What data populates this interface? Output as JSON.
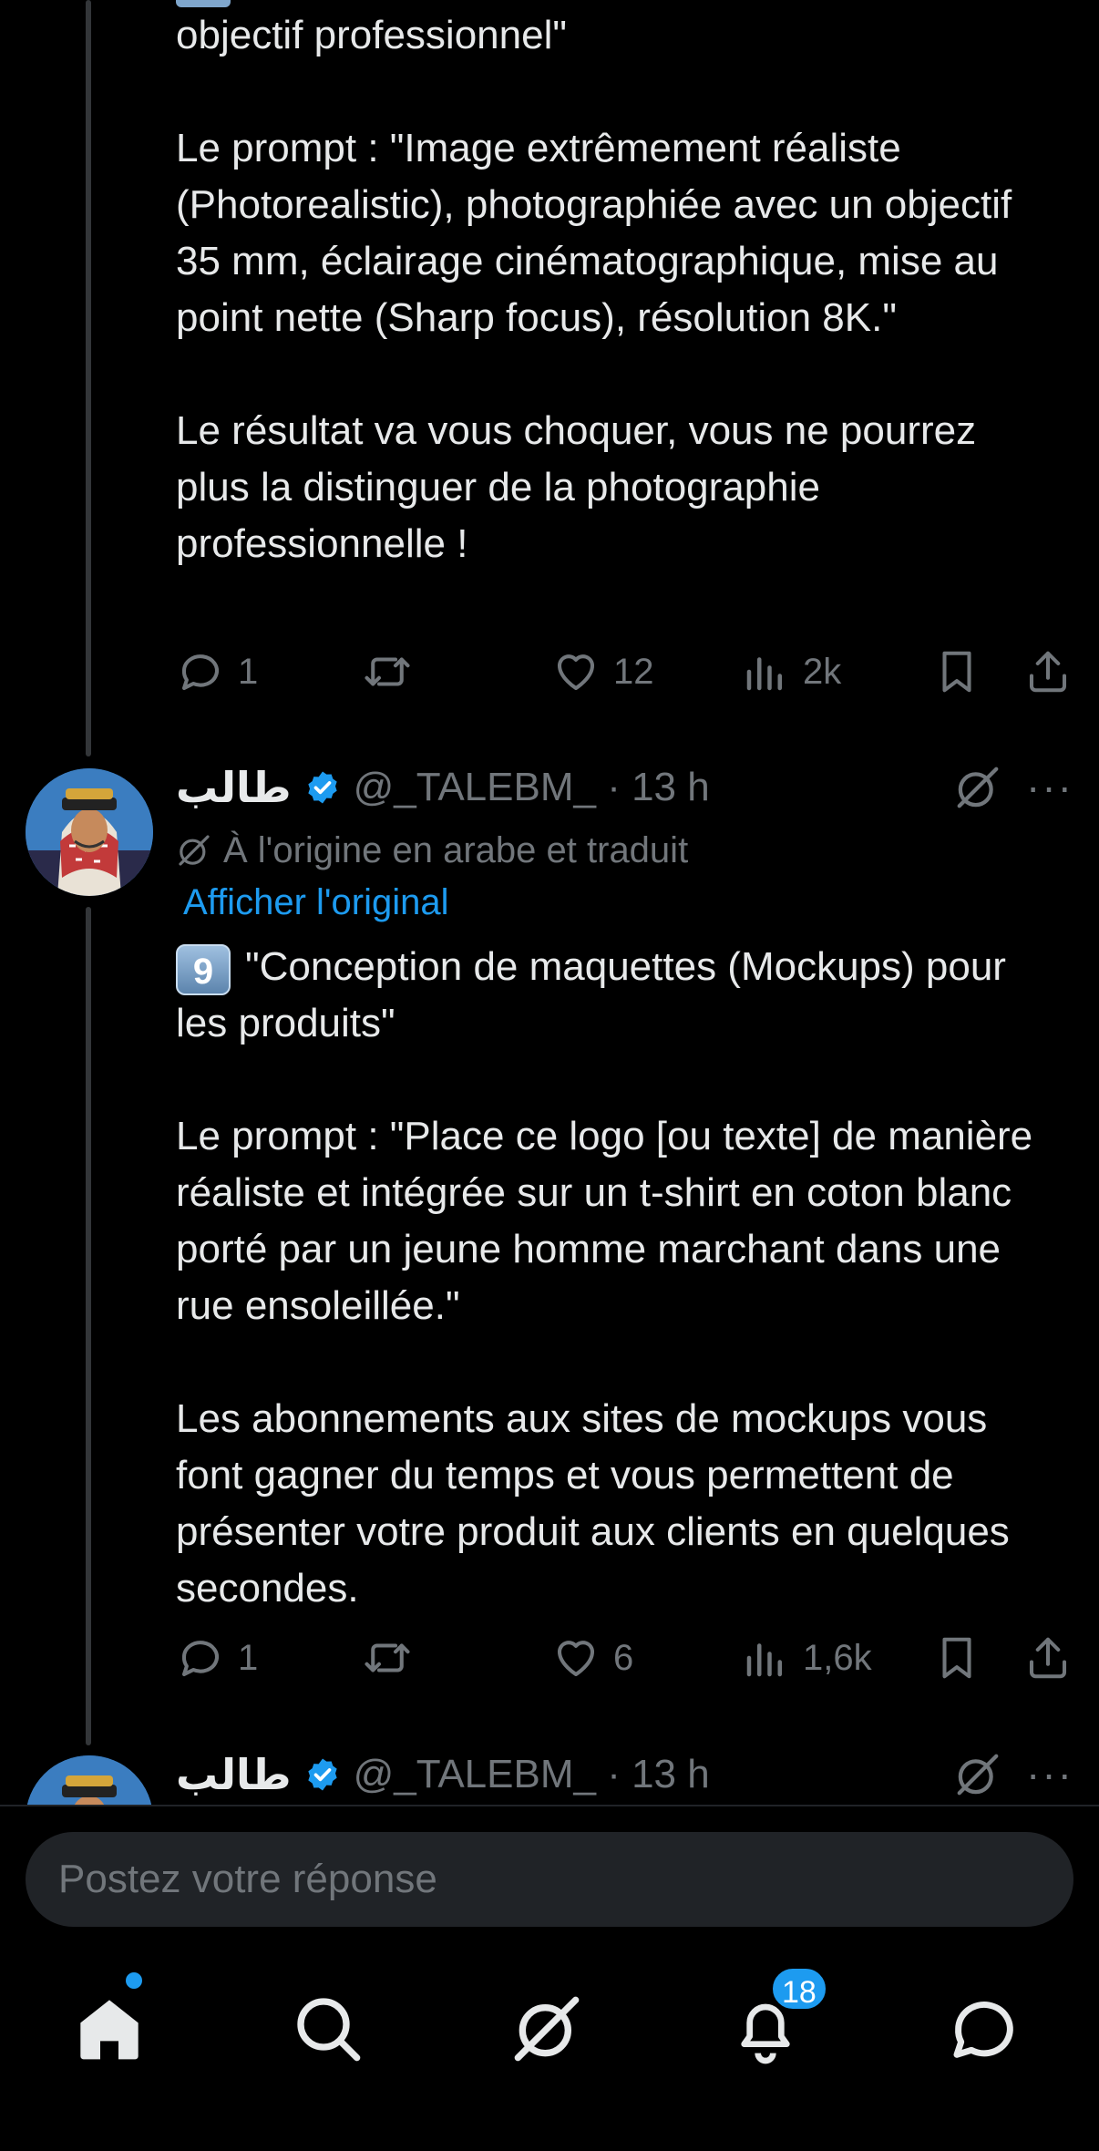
{
  "tweet1": {
    "text": "objectif professionnel\"\n\nLe prompt : \"Image extrêmement réaliste (Photorealistic), photographiée avec un objectif 35 mm, éclairage cinématographique, mise au point nette (Sharp focus), résolution 8K.\"\n\nLe résultat va vous choquer, vous ne pourrez plus la distinguer de la photographie professionnelle !",
    "replies": "1",
    "retweets": "",
    "likes": "12",
    "views": "2k"
  },
  "tweet2": {
    "name": "طالب",
    "handle": "@_TALEBM_ · 13 h",
    "translated_note": "À l'origine en arabe et traduit",
    "show_original": "Afficher l'original",
    "keycap": "9",
    "text_first": "\"Conception de maquettes (Mockups) pour les produits\"",
    "text_rest": "Le prompt : \"Place ce logo [ou texte] de manière réaliste et intégrée sur un t-shirt en coton blanc porté par un jeune homme marchant dans une rue ensoleillée.\"\n\nLes abonnements aux sites de mockups vous font gagner du temps et vous permettent de présenter votre produit aux clients en quelques secondes.",
    "replies": "1",
    "likes": "6",
    "views": "1,6k"
  },
  "tweet3": {
    "name": "طالب",
    "handle": "@_TALEBM_ · 13 h"
  },
  "reply": {
    "placeholder": "Postez votre réponse"
  },
  "nav": {
    "notifications_badge": "18",
    "icons": [
      "home-icon",
      "search-icon",
      "grok-icon",
      "bell-icon",
      "messages-icon"
    ]
  },
  "colors": {
    "background": "#000000",
    "text": "#e7e9ea",
    "muted": "#71767b",
    "accent": "#1d9bf0"
  }
}
